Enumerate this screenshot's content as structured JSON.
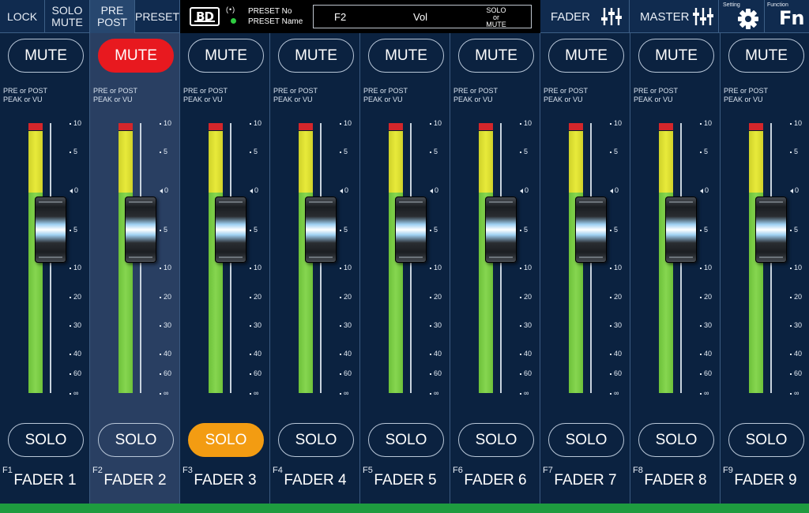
{
  "toolbar": {
    "lock": "LOCK",
    "solo_mute": [
      "SOLO",
      "MUTE"
    ],
    "pre_post": [
      "PRE",
      "POST"
    ],
    "preset": "PRESET",
    "logo": "BD",
    "signal": "(•)",
    "preset_no_label": "PRESET No",
    "preset_name_label": "PRESET Name",
    "info_channel": "F2",
    "info_param": "Vol",
    "info_mode": [
      "SOLO",
      "or",
      "MUTE"
    ],
    "fader_view": "FADER",
    "master_view": "MASTER",
    "setting_label": "Setting",
    "function_label": "Function",
    "function_button": "Fn"
  },
  "strip_labels": {
    "mute": "MUTE",
    "solo": "SOLO",
    "mode_line1": "PRE or POST",
    "mode_line2": "PEAK or VU"
  },
  "scale": [
    "10",
    "5",
    "0",
    "5",
    "10",
    "20",
    "30",
    "40",
    "60",
    "∞"
  ],
  "strips": [
    {
      "num": "F1",
      "name": "FADER 1",
      "mute_on": false,
      "solo_on": false,
      "selected": false
    },
    {
      "num": "F2",
      "name": "FADER 2",
      "mute_on": true,
      "solo_on": false,
      "selected": true
    },
    {
      "num": "F3",
      "name": "FADER 3",
      "mute_on": false,
      "solo_on": true,
      "selected": false
    },
    {
      "num": "F4",
      "name": "FADER 4",
      "mute_on": false,
      "solo_on": false,
      "selected": false
    },
    {
      "num": "F5",
      "name": "FADER 5",
      "mute_on": false,
      "solo_on": false,
      "selected": false
    },
    {
      "num": "F6",
      "name": "FADER 6",
      "mute_on": false,
      "solo_on": false,
      "selected": false
    },
    {
      "num": "F7",
      "name": "FADER 7",
      "mute_on": false,
      "solo_on": false,
      "selected": false
    },
    {
      "num": "F8",
      "name": "FADER 8",
      "mute_on": false,
      "solo_on": false,
      "selected": false
    },
    {
      "num": "F9",
      "name": "FADER 9",
      "mute_on": false,
      "solo_on": false,
      "selected": false
    }
  ],
  "colors": {
    "mute_active": "#e8191f",
    "solo_active": "#f39c12",
    "meter_red": "#d4262b",
    "meter_yellow": "#e8ea3a",
    "meter_green": "#86d650",
    "status_bar": "#1e9b3f"
  }
}
